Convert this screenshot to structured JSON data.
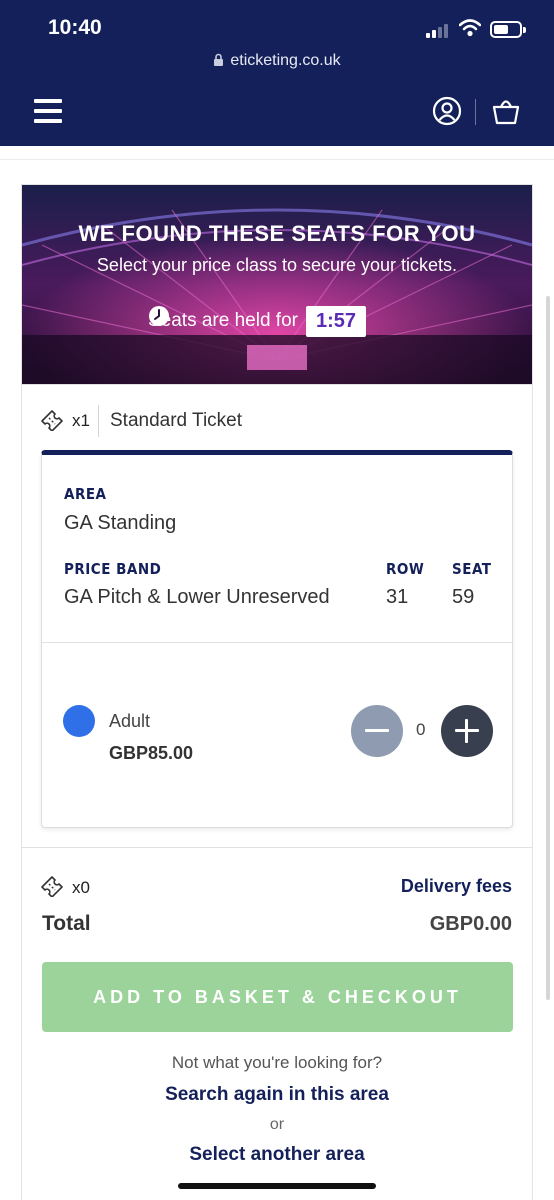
{
  "status_bar": {
    "time": "10:40"
  },
  "browser": {
    "url": "eticketing.co.uk"
  },
  "hero": {
    "title": "WE FOUND THESE SEATS FOR YOU",
    "subtitle": "Select your price class to secure your tickets.",
    "held_text": "Seats are held for",
    "timer": "1:57"
  },
  "ticket_summary": {
    "qty": "x1",
    "name": "Standard Ticket"
  },
  "seat": {
    "area_label": "AREA",
    "area_value": "GA Standing",
    "price_band_label": "PRICE BAND",
    "price_band_value": "GA Pitch & Lower Unreserved",
    "row_label": "ROW",
    "row_value": "31",
    "seat_label": "SEAT",
    "seat_value": "59"
  },
  "price_class": {
    "name": "Adult",
    "price": "GBP85.00",
    "quantity": "0",
    "color": "#2f6fe8"
  },
  "totals": {
    "qty": "x0",
    "delivery_fees": "Delivery fees",
    "total_label": "Total",
    "total_value": "GBP0.00"
  },
  "actions": {
    "checkout_label": "ADD TO BASKET & CHECKOUT",
    "not_looking": "Not what you're looking for?",
    "search_again": "Search again in this area",
    "or": "or",
    "select_another": "Select another area"
  },
  "colors": {
    "brand_navy": "#13205a",
    "checkout_disabled": "#9bd39a",
    "timer_purple": "#5a2bb6"
  }
}
